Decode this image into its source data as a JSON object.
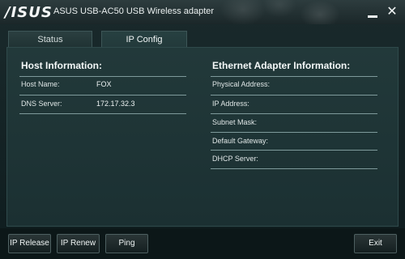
{
  "titlebar": {
    "brand": "/ISUS",
    "title": "ASUS USB-AC50 USB Wireless adapter",
    "minimize_icon": "minimize-icon",
    "close_icon": "close-icon"
  },
  "tabs": [
    {
      "label": "Status",
      "active": false
    },
    {
      "label": "IP Config",
      "active": true
    }
  ],
  "host": {
    "title": "Host Information:",
    "rows": [
      {
        "label": "Host Name:",
        "value": "FOX"
      },
      {
        "label": "DNS Server:",
        "value": "172.17.32.3"
      }
    ]
  },
  "ethernet": {
    "title": "Ethernet Adapter Information:",
    "rows": [
      {
        "label": "Physical Address:",
        "value": ""
      },
      {
        "label": "IP Address:",
        "value": ""
      },
      {
        "label": "Subnet Mask:",
        "value": ""
      },
      {
        "label": "Default Gateway:",
        "value": ""
      },
      {
        "label": "DHCP Server:",
        "value": ""
      }
    ]
  },
  "buttons": {
    "ip_release": "IP Release",
    "ip_renew": "IP Renew",
    "ping": "Ping",
    "exit": "Exit"
  },
  "colors": {
    "background": "#0d1a1b",
    "panel": "#22393a",
    "divider": "#7e9a9b"
  }
}
